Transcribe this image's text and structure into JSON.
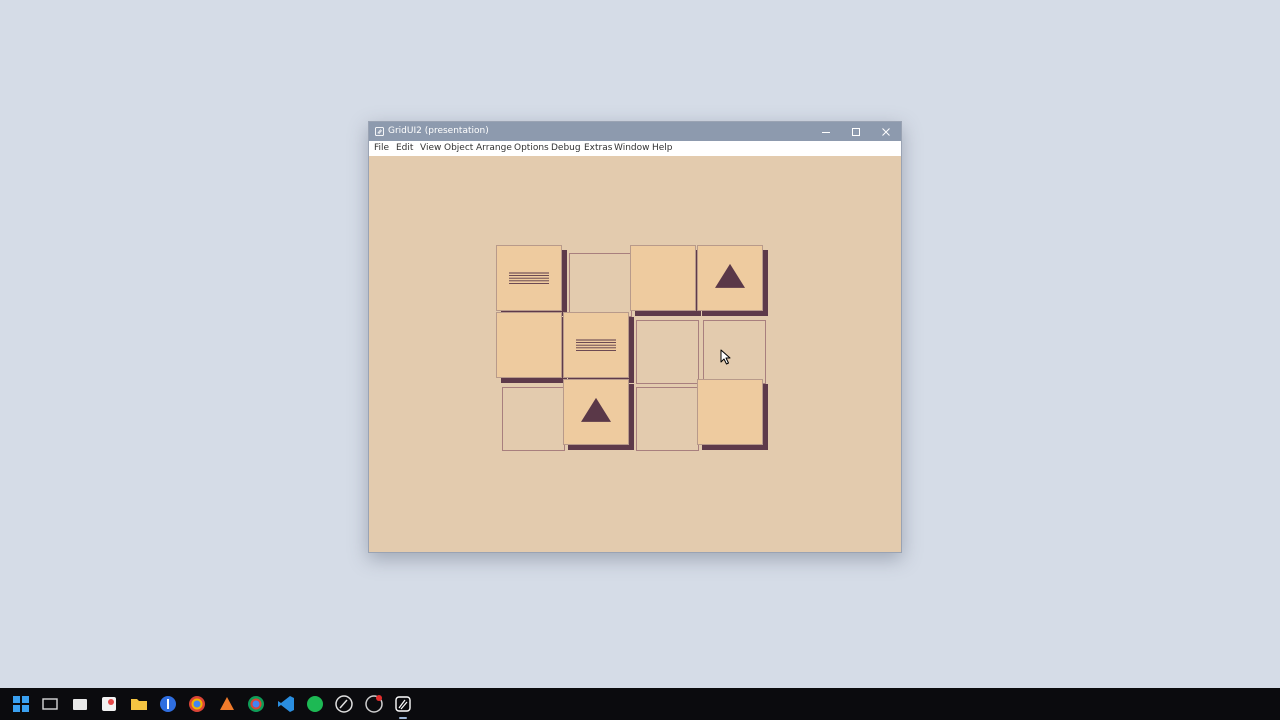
{
  "window": {
    "title": "GridUI2 (presentation)",
    "controls": {
      "minimize": "–",
      "maximize": "□",
      "close": "✕"
    }
  },
  "menu": {
    "items": [
      "File",
      "Edit",
      "View",
      "Object",
      "Arrange",
      "Options",
      "Debug",
      "Extras",
      "Window",
      "Help"
    ]
  },
  "board": {
    "rows": 3,
    "columns": 4,
    "cells": [
      {
        "row": 0,
        "col": 0,
        "kind": "tile",
        "symbol": "lines"
      },
      {
        "row": 0,
        "col": 1,
        "kind": "empty",
        "symbol": ""
      },
      {
        "row": 0,
        "col": 2,
        "kind": "tile",
        "symbol": ""
      },
      {
        "row": 0,
        "col": 3,
        "kind": "tile",
        "symbol": "triangle"
      },
      {
        "row": 1,
        "col": 0,
        "kind": "tile",
        "symbol": ""
      },
      {
        "row": 1,
        "col": 1,
        "kind": "tile",
        "symbol": "lines"
      },
      {
        "row": 1,
        "col": 2,
        "kind": "empty",
        "symbol": ""
      },
      {
        "row": 1,
        "col": 3,
        "kind": "empty",
        "symbol": ""
      },
      {
        "row": 2,
        "col": 0,
        "kind": "empty",
        "symbol": ""
      },
      {
        "row": 2,
        "col": 1,
        "kind": "tile",
        "symbol": "triangle"
      },
      {
        "row": 2,
        "col": 2,
        "kind": "empty",
        "symbol": ""
      },
      {
        "row": 2,
        "col": 3,
        "kind": "tile",
        "symbol": ""
      }
    ]
  },
  "colors": {
    "desktop": "#d5dce7",
    "titlebar": "#8d9aae",
    "canvas": "#e3cbae",
    "tile": "#eecb9f",
    "tile_shadow": "#5e3a4a",
    "symbol": "#5a3848"
  },
  "taskbar": {
    "icons": [
      "windows-start-icon",
      "task-view-icon",
      "screen-capture-icon",
      "paint-app-icon",
      "file-explorer-icon",
      "password-manager-icon",
      "chrome-icon",
      "tool-app-icon",
      "chrome-alt-icon",
      "vscode-icon",
      "spotify-icon",
      "pen-tool-icon",
      "recording-app-icon",
      "gridui-app-icon"
    ]
  }
}
